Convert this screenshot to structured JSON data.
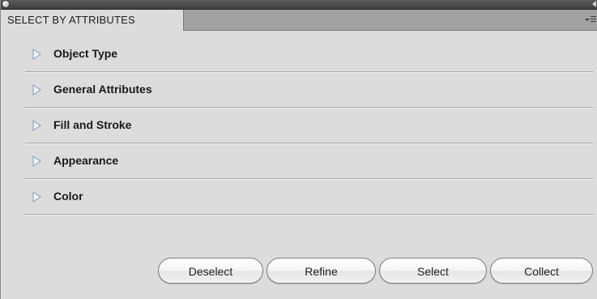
{
  "panel": {
    "tab_label": "SELECT BY ATTRIBUTES"
  },
  "sections": [
    {
      "label": "Object Type"
    },
    {
      "label": "General Attributes"
    },
    {
      "label": "Fill and Stroke"
    },
    {
      "label": "Appearance"
    },
    {
      "label": "Color"
    }
  ],
  "buttons": {
    "deselect": "Deselect",
    "refine": "Refine",
    "select": "Select",
    "collect": "Collect"
  },
  "icons": {
    "close": "close-icon",
    "collapse": "collapse-arrow-icon",
    "panel_menu": "panel-menu-icon",
    "disclosure": "disclosure-triangle-icon"
  },
  "colors": {
    "panel_bg": "#dcdcdc",
    "titlebar": "#4a4a4a",
    "tab_strip": "#a2a2a2",
    "disclosure_fill": "#e9f2fb",
    "disclosure_stroke": "#7e9ab8"
  }
}
